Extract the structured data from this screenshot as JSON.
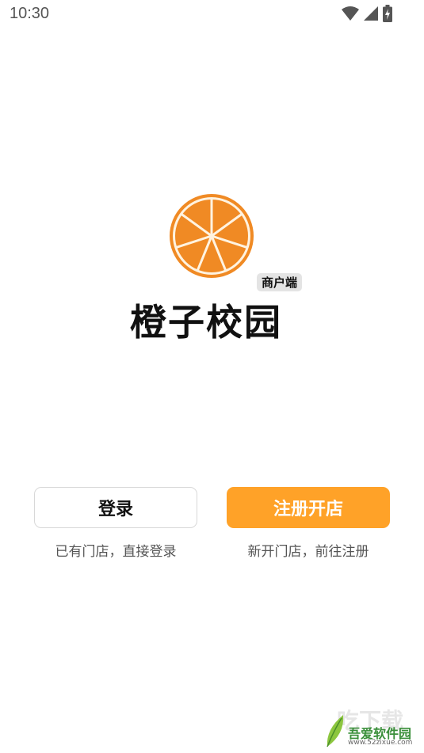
{
  "status_bar": {
    "time": "10:30",
    "icons": [
      "wifi-icon",
      "cell-signal-icon",
      "battery-charging-icon"
    ]
  },
  "brand": {
    "title": "橙子校园",
    "badge": "商户端",
    "logo": "orange-slice-logo"
  },
  "actions": {
    "login_label": "登录",
    "login_hint": "已有门店，直接登录",
    "register_label": "注册开店",
    "register_hint": "新开门店，前往注册"
  },
  "watermark": {
    "text": "吾爱软件园",
    "url": "www.52zixue.com",
    "bg_text": "吃下载"
  },
  "colors": {
    "accent": "#ffa228",
    "orange_peel": "#f08a24",
    "orange_pith": "#fff3e0",
    "text_primary": "#111111",
    "text_secondary": "#555555"
  }
}
